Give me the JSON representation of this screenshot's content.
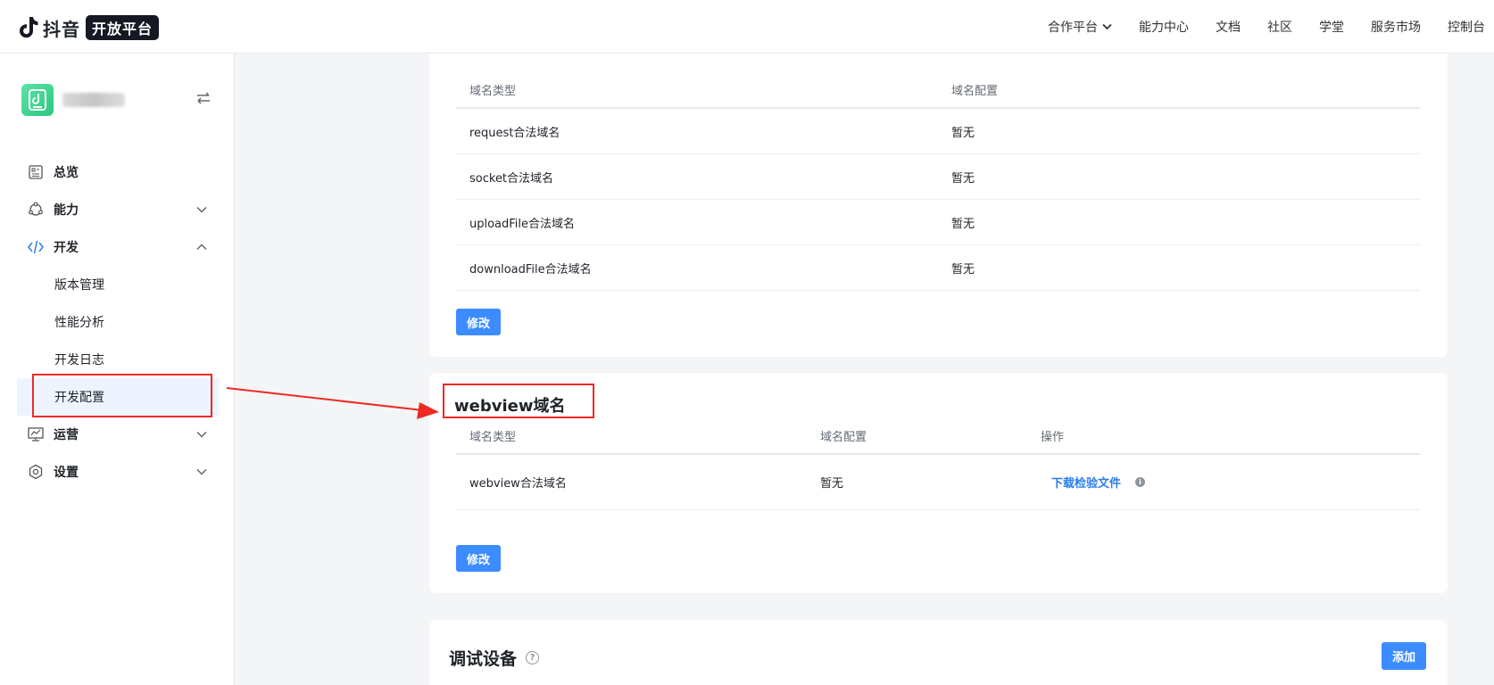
{
  "brand": {
    "name": "抖音",
    "badge": "开放平台"
  },
  "topnav": [
    {
      "label": "合作平台",
      "has_dropdown": true
    },
    {
      "label": "能力中心"
    },
    {
      "label": "文档"
    },
    {
      "label": "社区"
    },
    {
      "label": "学堂"
    },
    {
      "label": "服务市场"
    },
    {
      "label": "控制台"
    }
  ],
  "sidebar": {
    "menu": [
      {
        "label": "总览",
        "icon": "dashboard-icon"
      },
      {
        "label": "能力",
        "icon": "capability-icon",
        "expanded": false
      },
      {
        "label": "开发",
        "icon": "code-icon",
        "expanded": true
      },
      {
        "label": "运营",
        "icon": "operation-icon",
        "expanded": false
      },
      {
        "label": "设置",
        "icon": "settings-icon",
        "expanded": false
      }
    ],
    "dev_sub": [
      {
        "label": "版本管理"
      },
      {
        "label": "性能分析"
      },
      {
        "label": "开发日志"
      },
      {
        "label": "开发配置",
        "selected": true
      }
    ]
  },
  "server_domain": {
    "columns": [
      "域名类型",
      "域名配置"
    ],
    "rows": [
      [
        "request合法域名",
        "暂无"
      ],
      [
        "socket合法域名",
        "暂无"
      ],
      [
        "uploadFile合法域名",
        "暂无"
      ],
      [
        "downloadFile合法域名",
        "暂无"
      ]
    ],
    "edit_label": "修改"
  },
  "webview_domain": {
    "title": "webview域名",
    "columns": [
      "域名类型",
      "域名配置",
      "操作"
    ],
    "rows": [
      {
        "type": "webview合法域名",
        "config": "暂无",
        "action": "下载检验文件"
      }
    ],
    "edit_label": "修改"
  },
  "debug_devices": {
    "title": "调试设备",
    "add_label": "添加"
  },
  "colors": {
    "primary": "#3c8cff",
    "link": "#2b7de9",
    "annotation_red": "#ee2a24",
    "selected_bg": "#eef4ff"
  }
}
